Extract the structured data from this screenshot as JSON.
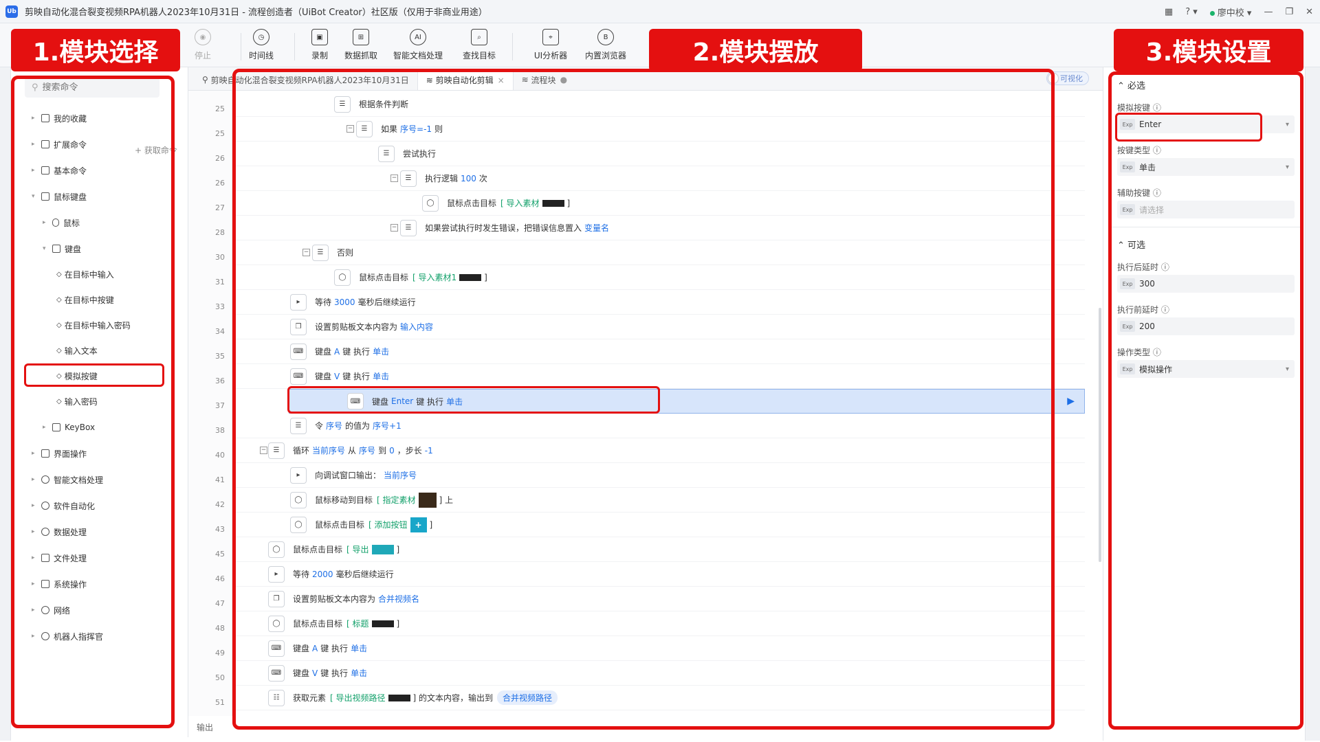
{
  "window": {
    "title": "剪映自动化混合裂变视频RPA机器人2023年10月31日 - 流程创造者（UiBot Creator）社区版（仅用于非商业用途）",
    "logo": "Ub",
    "user": "廖中校"
  },
  "toolbar": {
    "stop": "停止",
    "timeline": "时间线",
    "record": "录制",
    "data_scrape": "数据抓取",
    "smart_doc": "智能文档处理",
    "find_target": "查找目标",
    "ui_analyzer": "UI分析器",
    "builtin_browser": "内置浏览器"
  },
  "annotations": {
    "label1": "1.模块选择",
    "label2": "2.模块摆放",
    "label3": "3.模块设置"
  },
  "left": {
    "search_placeholder": "搜索命令",
    "fetch_cmd": "获取命令",
    "items": [
      "我的收藏",
      "扩展命令",
      "基本命令",
      "鼠标键盘",
      "鼠标",
      "键盘",
      "在目标中输入",
      "在目标中按键",
      "在目标中输入密码",
      "输入文本",
      "模拟按键",
      "输入密码",
      "KeyBox",
      "界面操作",
      "智能文档处理",
      "软件自动化",
      "数据处理",
      "文件处理",
      "系统操作",
      "网络",
      "机器人指挥官"
    ]
  },
  "tabs": [
    "剪映自动化混合裂变视频RPA机器人2023年10月31日",
    "剪映自动化剪辑",
    "流程块"
  ],
  "visualize": "可视化",
  "code": {
    "line_numbers": [
      "25",
      "25",
      "26",
      "26",
      "27",
      "28",
      "30",
      "31",
      "33",
      "34",
      "35",
      "36",
      "37",
      "38",
      "40",
      "41",
      "42",
      "43",
      "45",
      "46",
      "47",
      "48",
      "49",
      "50",
      "51"
    ],
    "rows": {
      "r0": "根据条件判断",
      "r1a": "如果",
      "r1b": "序号=-1",
      "r1c": "则",
      "r2": "尝试执行",
      "r3a": "执行逻辑",
      "r3b": "100",
      "r3c": "次",
      "r4a": "鼠标点击目标",
      "r4b": "[ 导入素材",
      "r4c": "]",
      "r5a": "如果尝试执行时发生错误，把错误信息置入",
      "r5b": "变量名",
      "r6": "否则",
      "r7a": "鼠标点击目标",
      "r7b": "[ 导入素材1",
      "r7c": "]",
      "r8a": "等待",
      "r8b": "3000",
      "r8c": "毫秒后继续运行",
      "r9a": "设置剪贴板文本内容为",
      "r9b": "输入内容",
      "r10a": "键盘",
      "r10b": "A",
      "r10c": "键 执行",
      "r10d": "单击",
      "r11a": "键盘",
      "r11b": "V",
      "r11c": "键 执行",
      "r11d": "单击",
      "r12a": "键盘",
      "r12b": "Enter",
      "r12c": "键 执行",
      "r12d": "单击",
      "r13a": "令",
      "r13b": "序号",
      "r13c": "的值为",
      "r13d": "序号+1",
      "r14a": "循环",
      "r14b": "当前序号",
      "r14c": "从",
      "r14d": "序号",
      "r14e": "到",
      "r14f": "0",
      "r14g": "，步长",
      "r14h": "-1",
      "r15a": "向调试窗口输出：",
      "r15b": "当前序号",
      "r16a": "鼠标移动到目标",
      "r16b": "[ 指定素材",
      "r16c": "] 上",
      "r17a": "鼠标点击目标",
      "r17b": "[ 添加按钮",
      "r17c": "]",
      "r18a": "鼠标点击目标",
      "r18b": "[ 导出",
      "r18c": "]",
      "r19a": "等待",
      "r19b": "2000",
      "r19c": "毫秒后继续运行",
      "r20a": "设置剪贴板文本内容为",
      "r20b": "合并视频名",
      "r21a": "鼠标点击目标",
      "r21b": "[ 标题",
      "r21c": "]",
      "r22a": "键盘",
      "r22b": "A",
      "r22c": "键 执行",
      "r22d": "单击",
      "r23a": "键盘",
      "r23b": "V",
      "r23c": "键 执行",
      "r23d": "单击",
      "r24a": "获取元素",
      "r24b": "[ 导出视频路径",
      "r24c": "] 的文本内容，输出到",
      "r24d": "合并视频路径"
    },
    "output_label": "输出"
  },
  "right": {
    "required": "必选",
    "optional": "可选",
    "fields": {
      "key_label": "模拟按键",
      "key_value": "Enter",
      "type_label": "按键类型",
      "type_value": "单击",
      "aux_label": "辅助按键",
      "aux_placeholder": "请选择",
      "after_label": "执行后延时",
      "after_value": "300",
      "before_label": "执行前延时",
      "before_value": "200",
      "op_label": "操作类型",
      "op_value": "模拟操作"
    },
    "exp": "Exp"
  }
}
